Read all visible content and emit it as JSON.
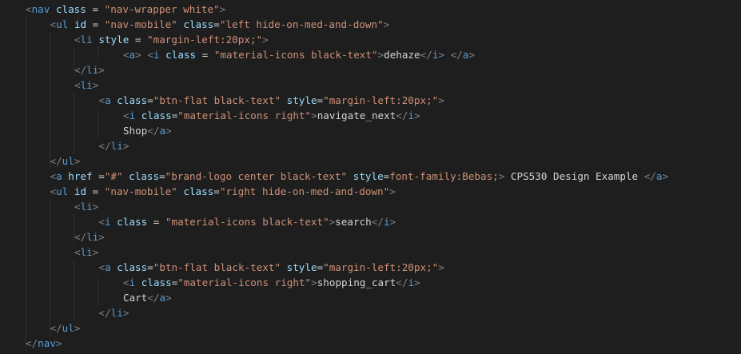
{
  "editor": {
    "language": "html",
    "colors": {
      "background": "#1e1e1e",
      "tag": "#569cd6",
      "punctuation": "#808080",
      "attribute": "#9cdcfe",
      "string": "#ce9178",
      "text": "#d4d4d4"
    },
    "lines": [
      [
        [
          "punc",
          "<"
        ],
        [
          "tag",
          "nav"
        ],
        [
          "ws",
          " "
        ],
        [
          "attr",
          "class"
        ],
        [
          "text",
          " = "
        ],
        [
          "str",
          "\"nav-wrapper white\""
        ],
        [
          "punc",
          ">"
        ]
      ],
      [
        [
          "punc",
          "<"
        ],
        [
          "tag",
          "ul"
        ],
        [
          "ws",
          " "
        ],
        [
          "attr",
          "id"
        ],
        [
          "text",
          " = "
        ],
        [
          "str",
          "\"nav-mobile\""
        ],
        [
          "ws",
          " "
        ],
        [
          "attr",
          "class"
        ],
        [
          "text",
          "="
        ],
        [
          "str",
          "\"left hide-on-med-and-down\""
        ],
        [
          "punc",
          ">"
        ]
      ],
      [
        [
          "punc",
          "<"
        ],
        [
          "tag",
          "li"
        ],
        [
          "ws",
          " "
        ],
        [
          "attr",
          "style"
        ],
        [
          "text",
          " = "
        ],
        [
          "str",
          "\"margin-left:20px;\""
        ],
        [
          "punc",
          ">"
        ]
      ],
      [
        [
          "punc",
          "<"
        ],
        [
          "tag",
          "a"
        ],
        [
          "punc",
          ">"
        ],
        [
          "ws",
          " "
        ],
        [
          "punc",
          "<"
        ],
        [
          "tag",
          "i"
        ],
        [
          "ws",
          " "
        ],
        [
          "attr",
          "class"
        ],
        [
          "text",
          " = "
        ],
        [
          "str",
          "\"material-icons black-text\""
        ],
        [
          "punc",
          ">"
        ],
        [
          "text",
          "dehaze"
        ],
        [
          "punc",
          "</"
        ],
        [
          "tag",
          "i"
        ],
        [
          "punc",
          ">"
        ],
        [
          "ws",
          " "
        ],
        [
          "punc",
          "</"
        ],
        [
          "tag",
          "a"
        ],
        [
          "punc",
          ">"
        ]
      ],
      [
        [
          "punc",
          "</"
        ],
        [
          "tag",
          "li"
        ],
        [
          "punc",
          ">"
        ]
      ],
      [
        [
          "punc",
          "<"
        ],
        [
          "tag",
          "li"
        ],
        [
          "punc",
          ">"
        ]
      ],
      [
        [
          "punc",
          "<"
        ],
        [
          "tag",
          "a"
        ],
        [
          "ws",
          " "
        ],
        [
          "attr",
          "class"
        ],
        [
          "text",
          "="
        ],
        [
          "str",
          "\"btn-flat black-text\""
        ],
        [
          "ws",
          " "
        ],
        [
          "attr",
          "style"
        ],
        [
          "text",
          "="
        ],
        [
          "str",
          "\"margin-left:20px;\""
        ],
        [
          "punc",
          ">"
        ]
      ],
      [
        [
          "punc",
          "<"
        ],
        [
          "tag",
          "i"
        ],
        [
          "ws",
          " "
        ],
        [
          "attr",
          "class"
        ],
        [
          "text",
          "="
        ],
        [
          "str",
          "\"material-icons right\""
        ],
        [
          "punc",
          ">"
        ],
        [
          "text",
          "navigate_next"
        ],
        [
          "punc",
          "</"
        ],
        [
          "tag",
          "i"
        ],
        [
          "punc",
          ">"
        ]
      ],
      [
        [
          "text",
          "Shop"
        ],
        [
          "punc",
          "</"
        ],
        [
          "tag",
          "a"
        ],
        [
          "punc",
          ">"
        ]
      ],
      [
        [
          "punc",
          "</"
        ],
        [
          "tag",
          "li"
        ],
        [
          "punc",
          ">"
        ]
      ],
      [
        [
          "punc",
          "</"
        ],
        [
          "tag",
          "ul"
        ],
        [
          "punc",
          ">"
        ]
      ],
      [
        [
          "punc",
          "<"
        ],
        [
          "tag",
          "a"
        ],
        [
          "ws",
          " "
        ],
        [
          "attr",
          "href"
        ],
        [
          "ws",
          " "
        ],
        [
          "text",
          "="
        ],
        [
          "str",
          "\"#\""
        ],
        [
          "ws",
          " "
        ],
        [
          "attr",
          "class"
        ],
        [
          "text",
          "="
        ],
        [
          "str",
          "\"brand-logo center black-text\""
        ],
        [
          "ws",
          " "
        ],
        [
          "attr",
          "style"
        ],
        [
          "text",
          "="
        ],
        [
          "str",
          "font-family:Bebas;"
        ],
        [
          "punc",
          ">"
        ],
        [
          "text",
          " CPS530 Design Example "
        ],
        [
          "punc",
          "</"
        ],
        [
          "tag",
          "a"
        ],
        [
          "punc",
          ">"
        ]
      ],
      [
        [
          "punc",
          "<"
        ],
        [
          "tag",
          "ul"
        ],
        [
          "ws",
          " "
        ],
        [
          "attr",
          "id"
        ],
        [
          "text",
          " = "
        ],
        [
          "str",
          "\"nav-mobile\""
        ],
        [
          "ws",
          " "
        ],
        [
          "attr",
          "class"
        ],
        [
          "text",
          "="
        ],
        [
          "str",
          "\"right hide-on-med-and-down\""
        ],
        [
          "punc",
          ">"
        ]
      ],
      [
        [
          "punc",
          "<"
        ],
        [
          "tag",
          "li"
        ],
        [
          "punc",
          ">"
        ]
      ],
      [
        [
          "punc",
          "<"
        ],
        [
          "tag",
          "i"
        ],
        [
          "ws",
          " "
        ],
        [
          "attr",
          "class"
        ],
        [
          "text",
          " = "
        ],
        [
          "str",
          "\"material-icons black-text\""
        ],
        [
          "punc",
          ">"
        ],
        [
          "text",
          "search"
        ],
        [
          "punc",
          "</"
        ],
        [
          "tag",
          "i"
        ],
        [
          "punc",
          ">"
        ]
      ],
      [
        [
          "punc",
          "</"
        ],
        [
          "tag",
          "li"
        ],
        [
          "punc",
          ">"
        ]
      ],
      [
        [
          "punc",
          "<"
        ],
        [
          "tag",
          "li"
        ],
        [
          "punc",
          ">"
        ]
      ],
      [
        [
          "punc",
          "<"
        ],
        [
          "tag",
          "a"
        ],
        [
          "ws",
          " "
        ],
        [
          "attr",
          "class"
        ],
        [
          "text",
          "="
        ],
        [
          "str",
          "\"btn-flat black-text\""
        ],
        [
          "ws",
          " "
        ],
        [
          "attr",
          "style"
        ],
        [
          "text",
          "="
        ],
        [
          "str",
          "\"margin-left:20px;\""
        ],
        [
          "punc",
          ">"
        ]
      ],
      [
        [
          "punc",
          "<"
        ],
        [
          "tag",
          "i"
        ],
        [
          "ws",
          " "
        ],
        [
          "attr",
          "class"
        ],
        [
          "text",
          "="
        ],
        [
          "str",
          "\"material-icons right\""
        ],
        [
          "punc",
          ">"
        ],
        [
          "text",
          "shopping_cart"
        ],
        [
          "punc",
          "</"
        ],
        [
          "tag",
          "i"
        ],
        [
          "punc",
          ">"
        ]
      ],
      [
        [
          "text",
          "Cart"
        ],
        [
          "punc",
          "</"
        ],
        [
          "tag",
          "a"
        ],
        [
          "punc",
          ">"
        ]
      ],
      [
        [
          "punc",
          "</"
        ],
        [
          "tag",
          "li"
        ],
        [
          "punc",
          ">"
        ]
      ],
      [
        [
          "punc",
          "</"
        ],
        [
          "tag",
          "ul"
        ],
        [
          "punc",
          ">"
        ]
      ],
      [
        [
          "punc",
          "</"
        ],
        [
          "tag",
          "nav"
        ],
        [
          "punc",
          ">"
        ]
      ]
    ]
  }
}
